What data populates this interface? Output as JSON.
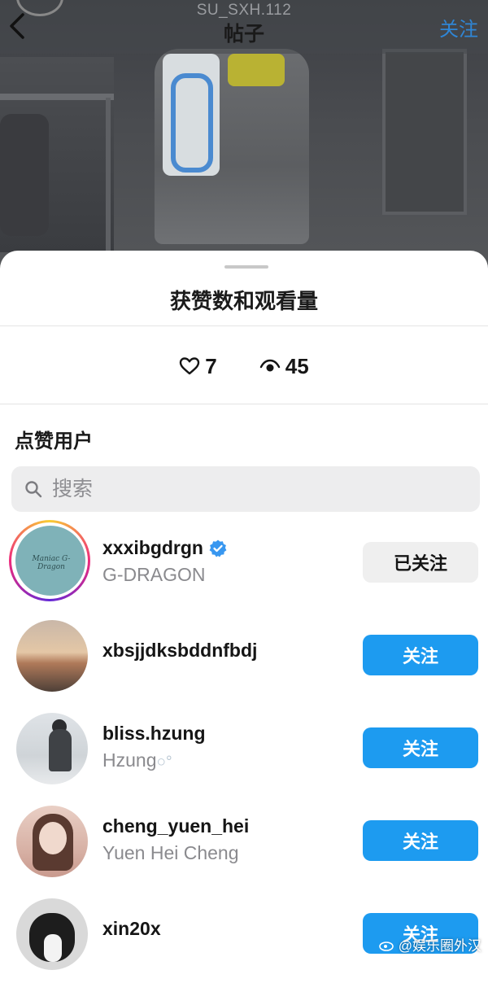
{
  "nav": {
    "username": "SU_SXH.112",
    "title": "帖子",
    "follow_label": "关注"
  },
  "sheet": {
    "title": "获赞数和观看量",
    "likes": "7",
    "views": "45",
    "section_label": "点赞用户",
    "search_placeholder": "搜索"
  },
  "users": [
    {
      "username": "xxxibgdrgn",
      "fullname": "G-DRAGON",
      "verified": true,
      "button": "已关注",
      "avatar_text": "Maniac G-Dragon"
    },
    {
      "username": "xbsjjdksbddnfbdj",
      "fullname": "",
      "button": "关注"
    },
    {
      "username": "bliss.hzung",
      "fullname": "Hzung",
      "fullname_suffix": "○°",
      "button": "关注"
    },
    {
      "username": "cheng_yuen_hei",
      "fullname": "Yuen Hei Cheng",
      "button": "关注"
    },
    {
      "username": "xin20x",
      "fullname": "",
      "button": "关注"
    }
  ],
  "watermark": "@娱乐圈外汉",
  "colors": {
    "accent": "#1d9bf0",
    "verified": "#3897f0"
  }
}
